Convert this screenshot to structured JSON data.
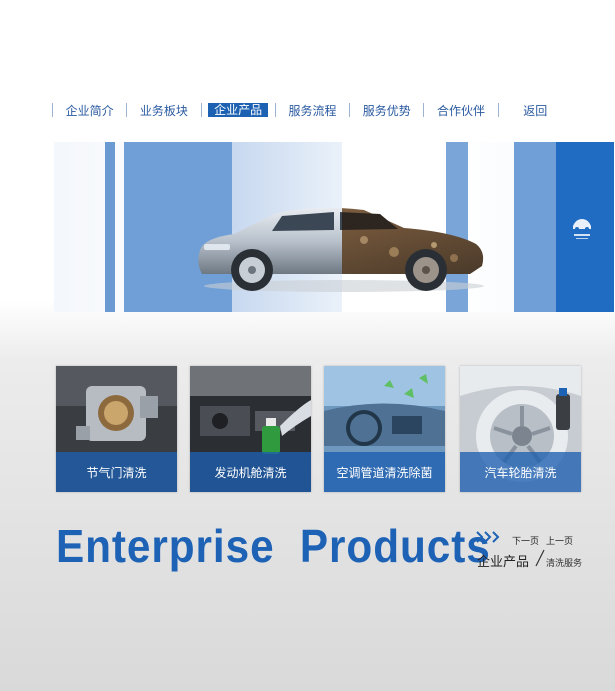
{
  "nav": {
    "items": [
      {
        "label": "企业简介",
        "active": false
      },
      {
        "label": "业务板块",
        "active": false
      },
      {
        "label": "企业产品",
        "active": true
      },
      {
        "label": "服务流程",
        "active": false
      },
      {
        "label": "服务优势",
        "active": false
      },
      {
        "label": "合作伙伴",
        "active": false
      },
      {
        "label": "返回",
        "active": false
      }
    ]
  },
  "banner": {
    "logo_icon": "car-wash-logo-icon"
  },
  "products": [
    {
      "label": "节气门清洗",
      "icon": "throttle-body"
    },
    {
      "label": "发动机舱清洗",
      "icon": "engine-bay"
    },
    {
      "label": "空调管道清洗除菌",
      "icon": "car-interior"
    },
    {
      "label": "汽车轮胎清洗",
      "icon": "car-wheel"
    }
  ],
  "footer": {
    "title_en": "Enterprise  Products",
    "next_page": "下一页",
    "prev_page": "上一页",
    "title_cn": "企业产品",
    "subtitle_cn": "清洗服务"
  },
  "colors": {
    "accent": "#1d62b5",
    "nav_text": "#2a5aa0",
    "card_overlay": "#1e5faf"
  }
}
